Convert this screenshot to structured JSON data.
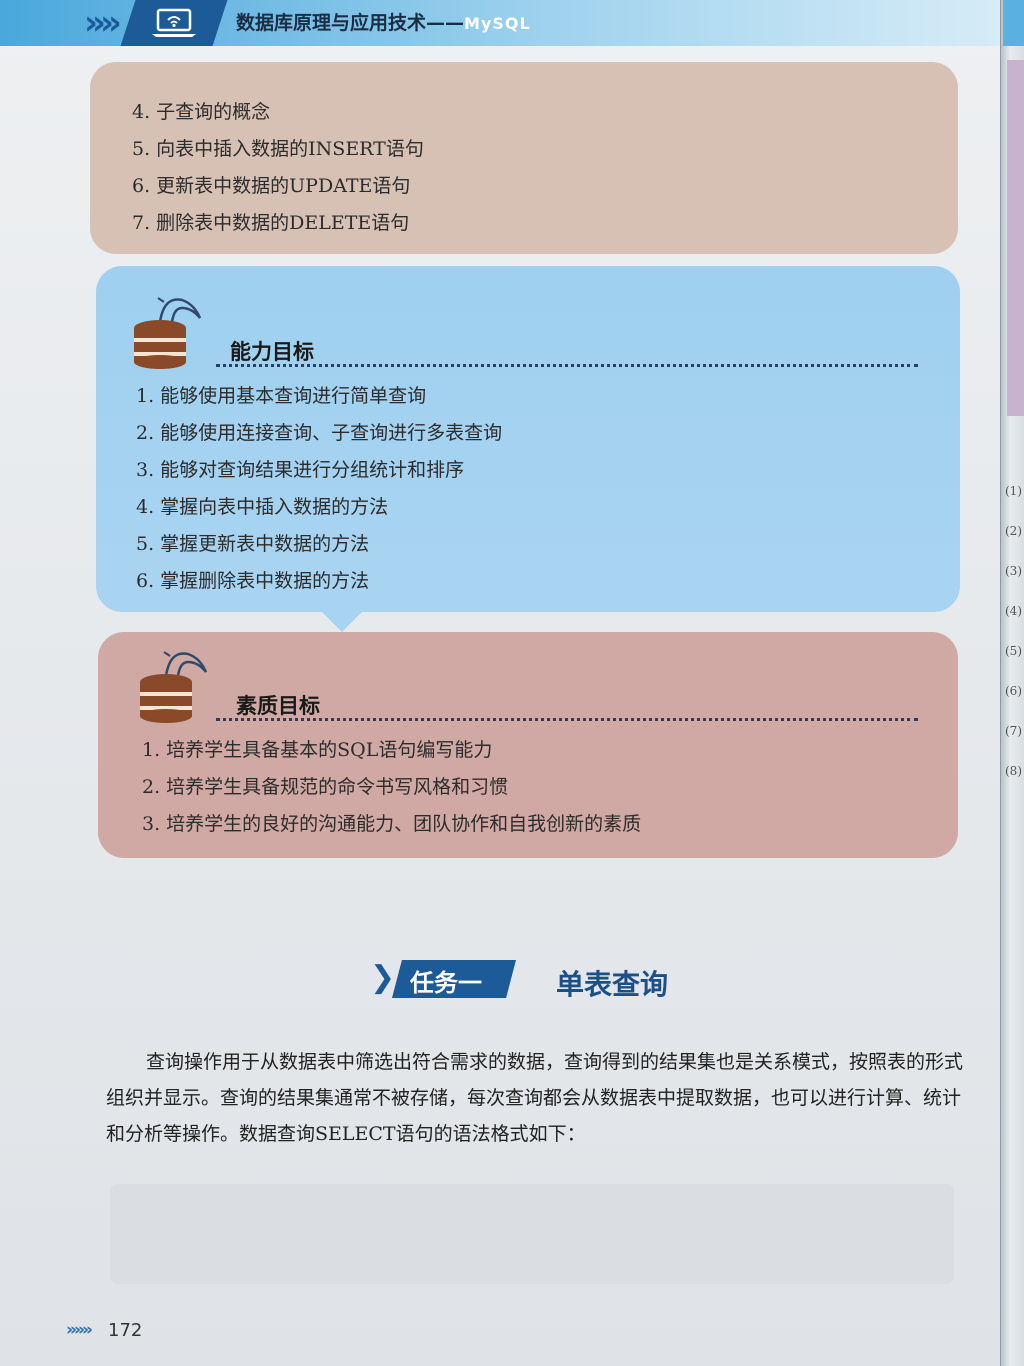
{
  "header": {
    "title": "数据库原理与应用技术——",
    "title_suffix": "MySQL"
  },
  "knowledge_items": [
    "4. 子查询的概念",
    "5. 向表中插入数据的INSERT语句",
    "6. 更新表中数据的UPDATE语句",
    "7. 删除表中数据的DELETE语句"
  ],
  "ability": {
    "heading": "能力目标",
    "items": [
      "1. 能够使用基本查询进行简单查询",
      "2. 能够使用连接查询、子查询进行多表查询",
      "3. 能够对查询结果进行分组统计和排序",
      "4. 掌握向表中插入数据的方法",
      "5. 掌握更新表中数据的方法",
      "6. 掌握删除表中数据的方法"
    ]
  },
  "quality": {
    "heading": "素质目标",
    "items": [
      "1. 培养学生具备基本的SQL语句编写能力",
      "2. 培养学生具备规范的命令书写风格和习惯",
      "3. 培养学生的良好的沟通能力、团队协作和自我创新的素质"
    ]
  },
  "task": {
    "badge": "任务一",
    "title": "单表查询"
  },
  "body_paragraph": "查询操作用于从数据表中筛选出符合需求的数据，查询得到的结果集也是关系模式，按照表的形式组织并显示。查询的结果集通常不被存储，每次查询都会从数据表中提取数据，也可以进行计算、统计和分析等操作。数据查询SELECT语句的语法格式如下：",
  "footer": {
    "chevrons": "»»»",
    "page_number": "172"
  },
  "next_page_fragments": [
    "(1)",
    "(2)",
    "(3)",
    "(4)",
    "(5)",
    "(6)",
    "(7)",
    "(8)"
  ],
  "colors": {
    "header_blue": "#1d5a98",
    "knowledge_panel": "#d6c1b4",
    "ability_panel": "#a9d4f1",
    "quality_panel": "#d1a9a4"
  },
  "icons": [
    "laptop-icon",
    "database-dolphin-icon"
  ]
}
